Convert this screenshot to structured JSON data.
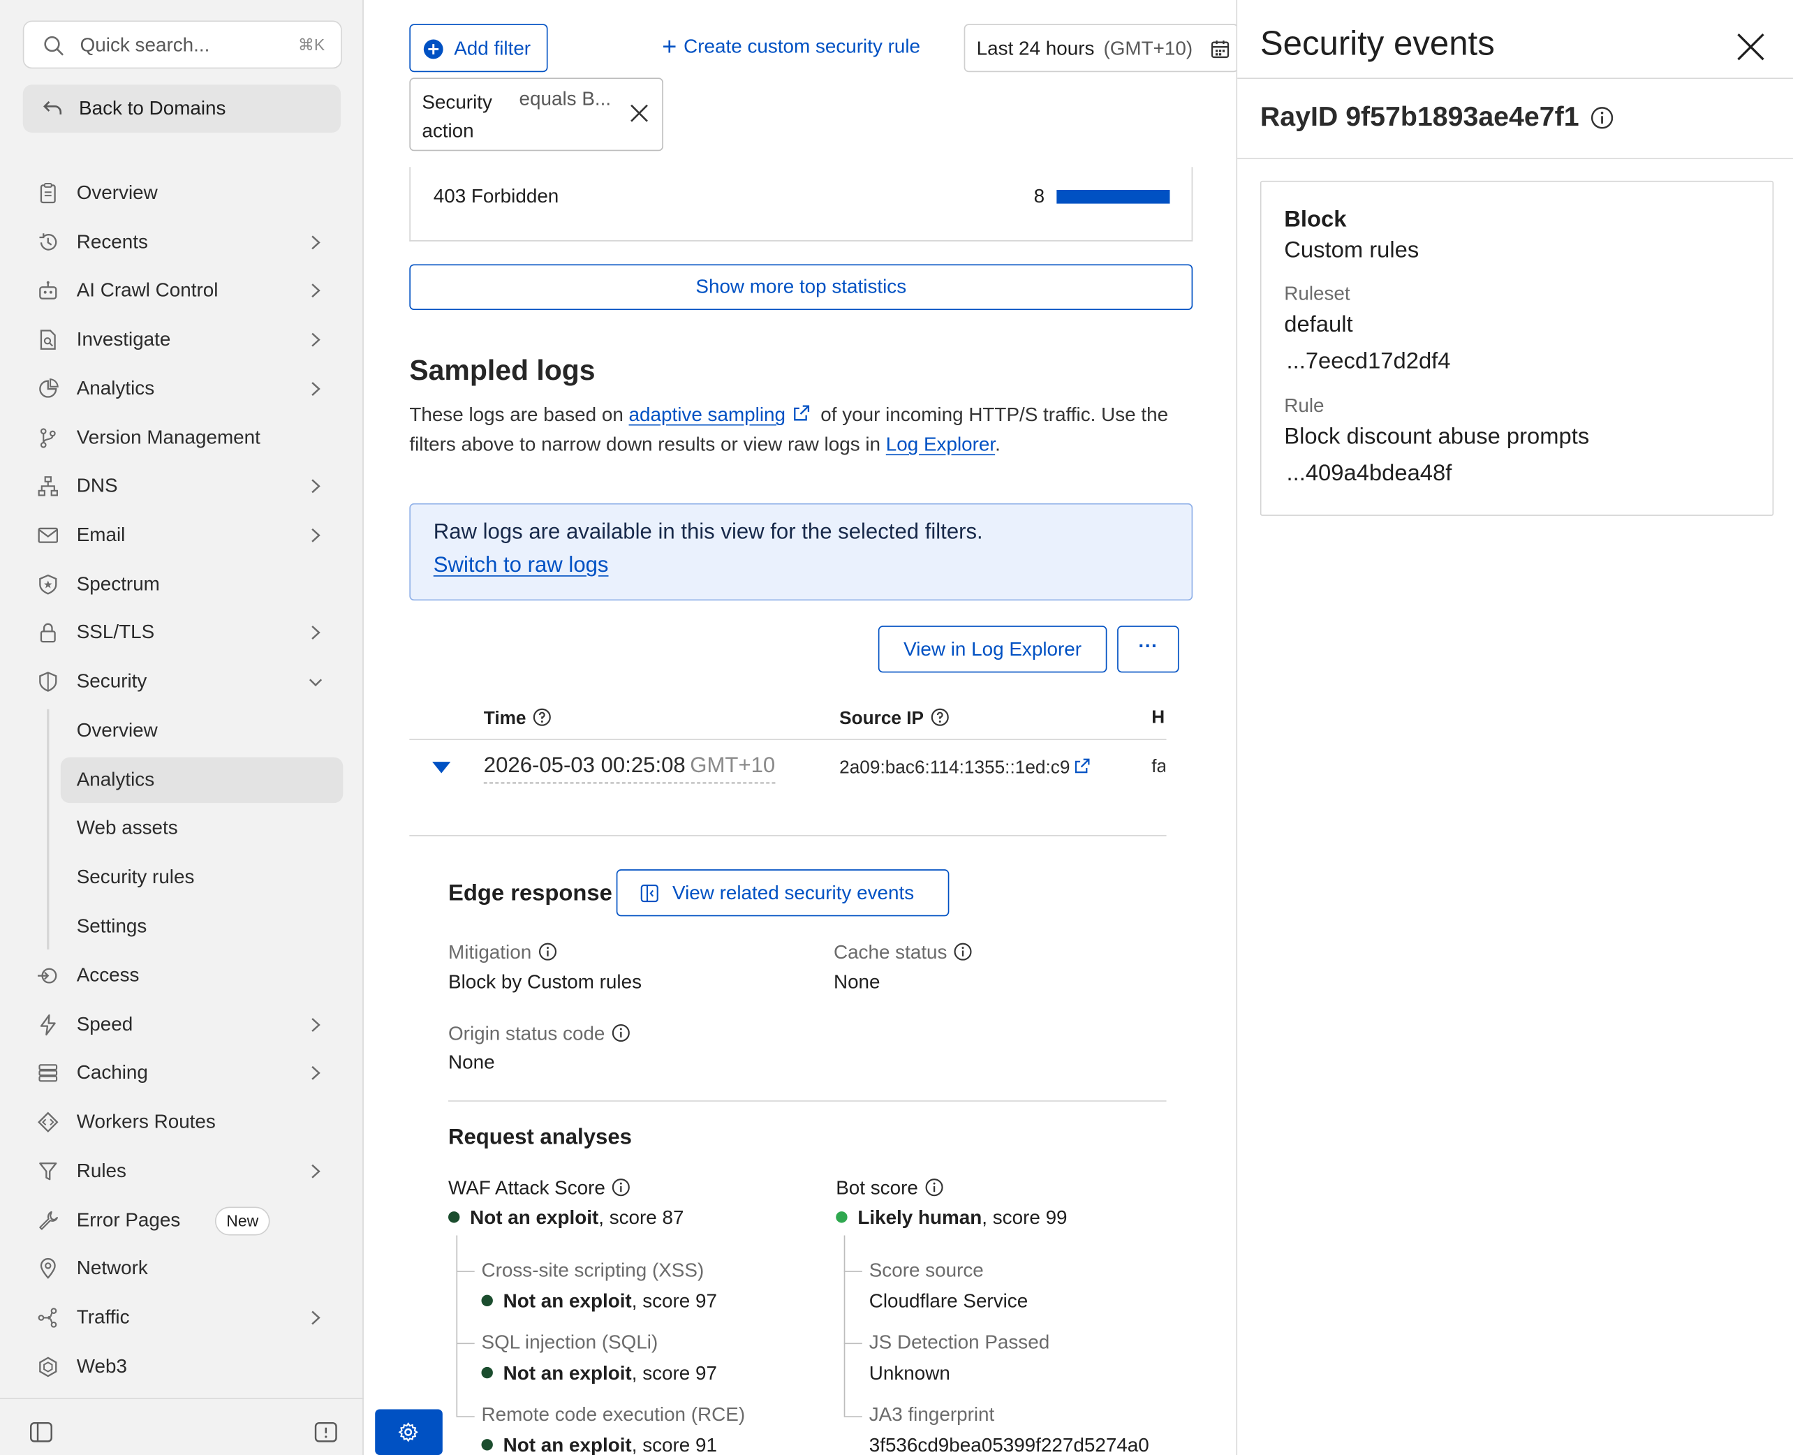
{
  "sidebar": {
    "search": {
      "placeholder": "Quick search...",
      "shortcut": "⌘K"
    },
    "back_label": "Back to Domains",
    "items": [
      {
        "label": "Overview",
        "icon": "clipboard-icon",
        "chevron": false
      },
      {
        "label": "Recents",
        "icon": "history-icon",
        "chevron": true
      },
      {
        "label": "AI Crawl Control",
        "icon": "robot-icon",
        "chevron": true
      },
      {
        "label": "Investigate",
        "icon": "document-search-icon",
        "chevron": true
      },
      {
        "label": "Analytics",
        "icon": "pie-chart-icon",
        "chevron": true
      },
      {
        "label": "Version Management",
        "icon": "git-branch-icon",
        "chevron": false
      },
      {
        "label": "DNS",
        "icon": "network-tree-icon",
        "chevron": true
      },
      {
        "label": "Email",
        "icon": "envelope-icon",
        "chevron": true
      },
      {
        "label": "Spectrum",
        "icon": "shield-star-icon",
        "chevron": false
      },
      {
        "label": "SSL/TLS",
        "icon": "lock-icon",
        "chevron": true
      },
      {
        "label": "Security",
        "icon": "shield-icon",
        "chevron": "down"
      }
    ],
    "security_sub": [
      {
        "label": "Overview",
        "active": false
      },
      {
        "label": "Analytics",
        "active": true
      },
      {
        "label": "Web assets",
        "active": false
      },
      {
        "label": "Security rules",
        "active": false
      },
      {
        "label": "Settings",
        "active": false
      }
    ],
    "items_after": [
      {
        "label": "Access",
        "icon": "access-arrow-icon",
        "chevron": false
      },
      {
        "label": "Speed",
        "icon": "bolt-icon",
        "chevron": true
      },
      {
        "label": "Caching",
        "icon": "server-stack-icon",
        "chevron": true
      },
      {
        "label": "Workers Routes",
        "icon": "diamond-code-icon",
        "chevron": false
      },
      {
        "label": "Rules",
        "icon": "funnel-icon",
        "chevron": true
      },
      {
        "label": "Error Pages",
        "icon": "wrench-icon",
        "chevron": false,
        "badge": "New"
      },
      {
        "label": "Network",
        "icon": "location-pin-icon",
        "chevron": false
      },
      {
        "label": "Traffic",
        "icon": "traffic-nodes-icon",
        "chevron": true
      },
      {
        "label": "Web3",
        "icon": "web3-hexagon-icon",
        "chevron": false
      }
    ]
  },
  "toolbar": {
    "add_filter_label": "Add filter",
    "create_rule_label": "Create custom security rule",
    "time_range": "Last 24 hours",
    "timezone": "(GMT+10)"
  },
  "filter_chip": {
    "key": "Security action",
    "operator": "equals B..."
  },
  "top_stat": {
    "label": "403 Forbidden",
    "count": "8",
    "fill_fraction": 1.0
  },
  "show_more_label": "Show more top statistics",
  "sampled_logs": {
    "title": "Sampled logs",
    "desc_pre": "These logs are based on ",
    "desc_link": "adaptive sampling",
    "desc_mid": " of your incoming HTTP/S traffic. Use the filters above to narrow down results or view raw logs in ",
    "desc_link2": "Log Explorer",
    "desc_post": "."
  },
  "raw_notice": {
    "text": "Raw logs are available in this view for the selected filters.",
    "link": "Switch to raw logs"
  },
  "actions": {
    "view_log_explorer": "View in Log Explorer",
    "more": "···"
  },
  "table": {
    "headers": {
      "time": "Time",
      "source_ip": "Source IP",
      "host": "H"
    },
    "row": {
      "time": "2026-05-03 00:25:08",
      "tz": "GMT+10",
      "source_ip": "2a09:bac6:114:1355::1ed:c9",
      "host": "fa"
    }
  },
  "edge_response": {
    "title": "Edge response",
    "related_button": "View related security events",
    "mitigation_label": "Mitigation",
    "mitigation_value": "Block by Custom rules",
    "cache_label": "Cache status",
    "cache_value": "None",
    "origin_label": "Origin status code",
    "origin_value": "None"
  },
  "request_analyses": {
    "title": "Request analyses",
    "waf": {
      "label": "WAF Attack Score",
      "verdict": "Not an exploit",
      "score": ", score 87",
      "children": [
        {
          "label": "Cross-site scripting (XSS)",
          "verdict": "Not an exploit",
          "score": ", score 97"
        },
        {
          "label": "SQL injection (SQLi)",
          "verdict": "Not an exploit",
          "score": ", score 97"
        },
        {
          "label": "Remote code execution (RCE)",
          "verdict": "Not an exploit",
          "score": ", score 91"
        }
      ]
    },
    "bot": {
      "label": "Bot score",
      "verdict": "Likely human",
      "score": ", score 99",
      "children": [
        {
          "label": "Score source",
          "value": "Cloudflare Service"
        },
        {
          "label": "JS Detection Passed",
          "value": "Unknown"
        },
        {
          "label": "JA3 fingerprint",
          "value": "3f536cd9bea05399f227d5274a0"
        }
      ]
    }
  },
  "panel": {
    "title": "Security events",
    "ray_id": "RayID 9f57b1893ae4e7f1",
    "action": "Block",
    "source": "Custom rules",
    "ruleset_label": "Ruleset",
    "ruleset_value": "default",
    "ruleset_id": "...7eecd17d2df4",
    "rule_label": "Rule",
    "rule_value": "Block discount abuse prompts",
    "rule_id": "...409a4bdea48f"
  },
  "colors": {
    "accent": "#0051c3",
    "sidebar_bg": "#f2f2f2",
    "notice_bg": "#eaf1fd",
    "dot_dark_green": "#1b4d2e",
    "dot_green": "#2fa84f"
  }
}
